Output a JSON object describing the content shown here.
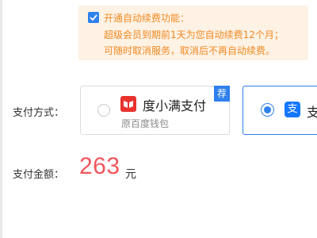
{
  "auto_renew": {
    "checked": true,
    "title": "开通自动续费功能：",
    "line2": "超级会员到期前1天为您自动续费12个月；",
    "line3": "可随时取消服务，取消后不再自动续费。",
    "text_color": "#f08a24",
    "bg_color": "#fdf2e4"
  },
  "payment": {
    "label": "支付方式：",
    "options": [
      {
        "name": "度小满支付",
        "sub": "原百度钱包",
        "badge": "荐",
        "icon": "duxiaoman-logo-icon",
        "selected": false
      },
      {
        "name": "支",
        "icon_glyph": "支",
        "icon": "alipay-logo-icon",
        "selected": true
      }
    ]
  },
  "amount": {
    "label": "支付金额：",
    "value": "263",
    "unit": "元",
    "color": "#f0565c"
  },
  "colors": {
    "accent": "#2f80ed",
    "duxiaoman_brand": "#e8332e",
    "alipay_brand": "#1677ff"
  }
}
